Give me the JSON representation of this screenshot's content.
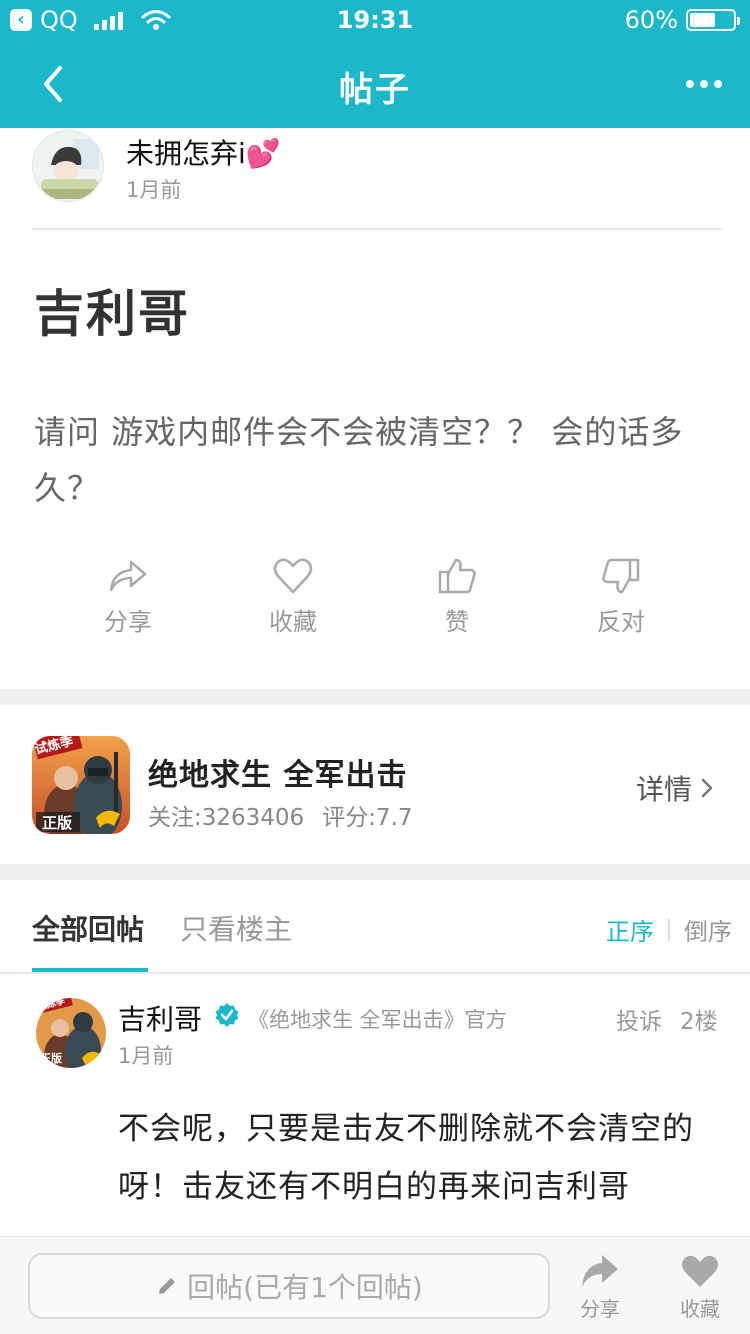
{
  "status_bar": {
    "carrier": "QQ",
    "time": "19:31",
    "battery": "60%",
    "battery_level": 0.6
  },
  "nav": {
    "title": "帖子"
  },
  "post": {
    "author_name": "未拥怎弃i💕",
    "author_time": "1月前",
    "title": "吉利哥",
    "body": "请问  游戏内邮件会不会被清空？？ 会的话多久？"
  },
  "actions": {
    "share": "分享",
    "favorite": "收藏",
    "like": "赞",
    "oppose": "反对"
  },
  "game": {
    "name": "绝地求生 全军出击",
    "followers": "关注:3263406",
    "rating": "评分:7.7",
    "detail": "详情",
    "badge_top": "试炼季",
    "badge_bottom": "正版"
  },
  "tabs": {
    "all_replies": "全部回帖",
    "owner_only": "只看楼主",
    "sort_asc": "正序",
    "sort_desc": "倒序"
  },
  "reply": {
    "author_name": "吉利哥",
    "official": "《绝地求生 全军出击》官方",
    "report": "投诉",
    "floor": "2楼",
    "time": "1月前",
    "body": "不会呢，只要是击友不删除就不会清空的呀！击友还有不明白的再来问吉利哥",
    "avatar_badge_top": "试炼季",
    "avatar_badge_bottom": "正版"
  },
  "bottom_bar": {
    "reply_placeholder": "回帖(已有1个回帖)",
    "share": "分享",
    "favorite": "收藏"
  },
  "colors": {
    "accent": "#1ab8c8"
  }
}
